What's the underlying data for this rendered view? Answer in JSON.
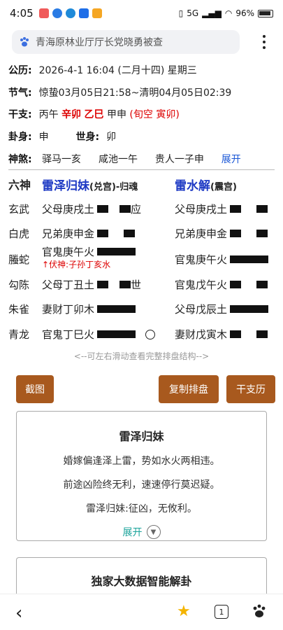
{
  "status": {
    "time": "4:05",
    "signal": "5G",
    "battery": "96%"
  },
  "search": {
    "query": "青海原林业厅厅长党晓勇被查"
  },
  "info": {
    "gongli_label": "公历:",
    "gongli_value": "2026-4-1 16:04 (二月十四) 星期三",
    "jieqi_label": "节气:",
    "jieqi_value": "惊蛰03月05日21:58~清明04月05日02:39",
    "ganzhi_label": "干支:",
    "gz_year": "丙午",
    "gz_month": "辛卯",
    "gz_day": "乙巳",
    "gz_hour": "甲申",
    "gz_kong": "(旬空 寅卯)",
    "guashen_label": "卦身:",
    "guashen_value": "申",
    "shishen_label": "世身:",
    "shishen_value": "卯",
    "shensha_label": "神煞:",
    "shensha_1": "驿马一亥",
    "shensha_2": "咸池一午",
    "shensha_3": "贵人一子申",
    "shensha_expand": "展开"
  },
  "table": {
    "col_liushen": "六神",
    "main_gua": "雷泽归妹",
    "main_palace": "(兑宫)-归魂",
    "change_gua": "雷水解",
    "change_palace": "(震宫)",
    "rows": [
      {
        "shen": "玄武",
        "left": "父母庚戌土",
        "mark": "应",
        "right": "父母庚戌土"
      },
      {
        "shen": "白虎",
        "left": "兄弟庚申金",
        "mark": "",
        "right": "兄弟庚申金"
      },
      {
        "shen": "螣蛇",
        "left": "官鬼庚午火",
        "mark": "",
        "right": "官鬼庚午火"
      },
      {
        "shen": "勾陈",
        "left": "父母丁丑土",
        "mark": "世",
        "right": "官鬼戊午火"
      },
      {
        "shen": "朱雀",
        "left": "妻财丁卯木",
        "mark": "",
        "right": "父母戊辰土"
      },
      {
        "shen": "青龙",
        "left": "官鬼丁巳火",
        "mark": "",
        "right": "妻财戊寅木"
      }
    ],
    "fushen": "↑伏神:子孙丁亥水"
  },
  "hint": "<--可左右滑动查看完整排盘结构-->",
  "buttons": {
    "screenshot": "截图",
    "copy": "复制排盘",
    "ganzhi": "干支历"
  },
  "card1": {
    "title": "雷泽归妹",
    "line1": "婚嫁偏逢泽上雷，势如水火两相违。",
    "line2": "前途凶险终无利，速速停行莫迟疑。",
    "line3": "雷泽归妹:征凶，无攸利。",
    "expand": "展开"
  },
  "card2": {
    "title": "独家大数据智能解卦"
  },
  "bottom": {
    "tabs_count": "1"
  }
}
